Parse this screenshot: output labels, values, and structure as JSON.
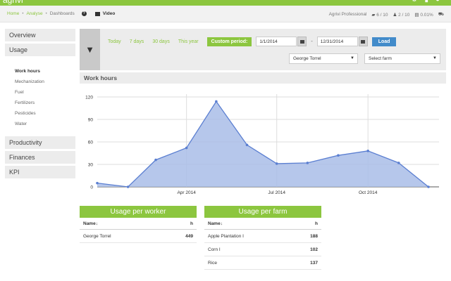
{
  "app": {
    "logo": "agrivi"
  },
  "breadcrumb": {
    "home": "Home",
    "analyse": "Analyse",
    "dashboards": "Dashboards",
    "help": "?",
    "video": "Video"
  },
  "account": {
    "plan": "Agrivi Professional",
    "farms": "6 / 10",
    "users": "2 / 10",
    "storage": "0.01%"
  },
  "sidebar": {
    "overview": "Overview",
    "usage": "Usage",
    "usage_items": [
      "Work hours",
      "Mechanization",
      "Fuel",
      "Fertilizers",
      "Pesticides",
      "Water"
    ],
    "productivity": "Productivity",
    "finances": "Finances",
    "kpi": "KPI"
  },
  "filters": {
    "periods": [
      "Today",
      "7 days",
      "30 days",
      "This year"
    ],
    "custom_label": "Custom period:",
    "date_from": "1/1/2014",
    "date_to": "12/31/2014",
    "dash": "-",
    "load_label": "Load",
    "worker_value": "George Torrel",
    "farm_value": "Select farm"
  },
  "chart_title": "Work hours",
  "chart_data": {
    "type": "area",
    "title": "Work hours",
    "xlabel": "",
    "ylabel": "",
    "x": [
      "2014-01-01",
      "2014-02-01",
      "2014-03-01",
      "2014-04-01",
      "2014-05-01",
      "2014-06-01",
      "2014-07-01",
      "2014-08-01",
      "2014-09-01",
      "2014-10-01",
      "2014-11-01",
      "2014-12-01"
    ],
    "values": [
      5,
      0,
      36,
      52,
      114,
      56,
      31,
      32,
      42,
      48,
      32,
      0
    ],
    "yticks": [
      0,
      30,
      60,
      90,
      120
    ],
    "xticklabels": [
      "Apr 2014",
      "Jul 2014",
      "Oct 2014"
    ],
    "ylim": [
      0,
      120
    ],
    "grid": true,
    "fill_color": "#a9bde8",
    "line_color": "#5b7fd1"
  },
  "worker_table": {
    "title": "Usage per worker",
    "col_name": "Name",
    "col_unit": "h",
    "rows": [
      {
        "name": "George Torrel",
        "value": "449"
      }
    ]
  },
  "farm_table": {
    "title": "Usage per farm",
    "col_name": "Name",
    "col_unit": "h",
    "rows": [
      {
        "name": "Apple Plantation I",
        "value": "188"
      },
      {
        "name": "Corn I",
        "value": "102"
      },
      {
        "name": "Rice",
        "value": "137"
      }
    ]
  },
  "colors": {
    "accent": "#8cc63f",
    "primary": "#428bca"
  }
}
